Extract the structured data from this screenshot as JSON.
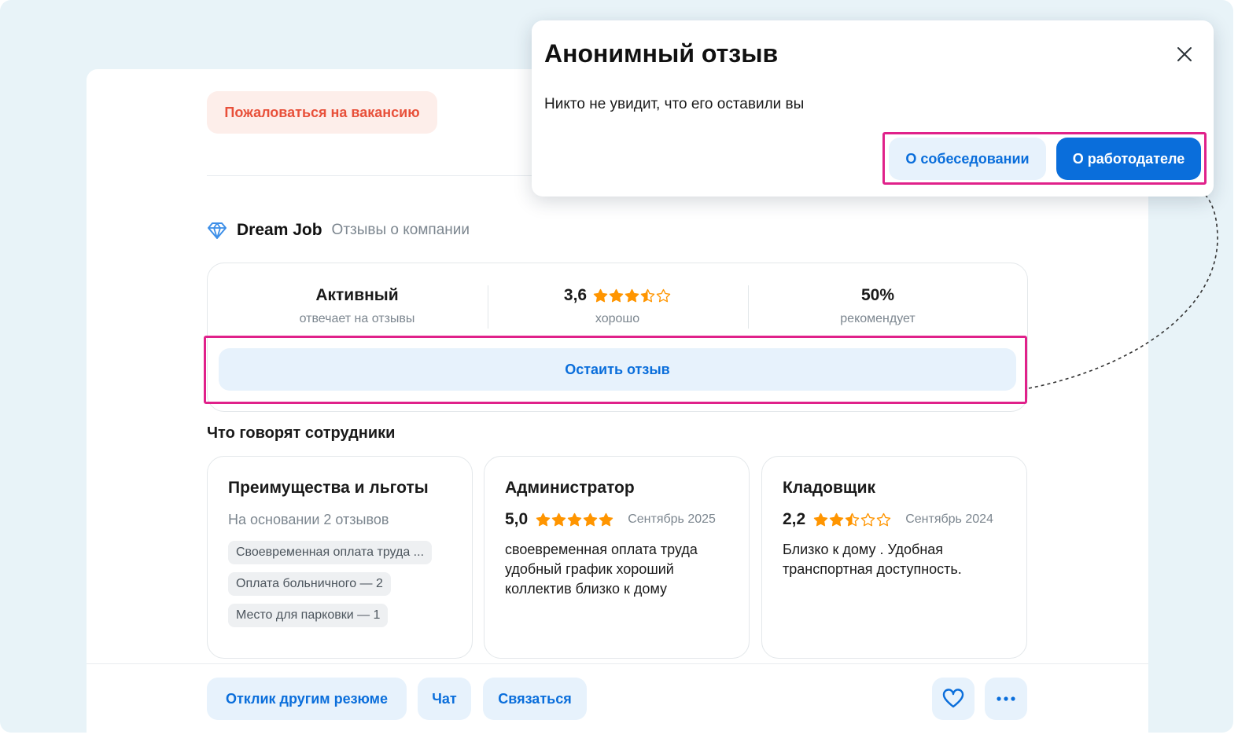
{
  "vacancy": {
    "complain_label": "Пожаловаться на вакансию"
  },
  "company": {
    "name": "Dream Job",
    "reviews_link": "Отзывы о компании",
    "stats": [
      {
        "value": "Активный",
        "label": "отвечает на отзывы"
      },
      {
        "value": "3,6",
        "label": "хорошо",
        "rating": 3.6
      },
      {
        "value": "50%",
        "label": "рекомендует"
      }
    ],
    "leave_review_label": "Остаить отзыв"
  },
  "employees": {
    "title": "Что говорят сотрудники",
    "benefits": {
      "title": "Преимущества и льготы",
      "subtitle": "На основании 2 отзывов",
      "tags": [
        "Своевременная оплата труда ...",
        "Оплата больничного — 2",
        "Место для парковки — 1"
      ]
    },
    "reviews": [
      {
        "role": "Администратор",
        "score": "5,0",
        "rating": 5.0,
        "date": "Сентябрь 2025",
        "text": "своевременная оплата труда удобный график хороший коллектив близко к дому"
      },
      {
        "role": "Кладовщик",
        "score": "2,2",
        "rating": 2.5,
        "date": "Сентябрь 2024",
        "text": "Близко к дому . Удобная транспортная доступность."
      }
    ]
  },
  "bottom_bar": {
    "respond_label": "Отклик другим резюме",
    "chat_label": "Чат",
    "contact_label": "Связаться"
  },
  "popup": {
    "title": "Анонимный отзыв",
    "text": "Никто не увидит, что его оставили вы",
    "interview_label": "О собеседовании",
    "employer_label": "О работодателе"
  },
  "colors": {
    "accent": "#0a6edb",
    "accent_light": "#e7f2fc",
    "star": "#ff9500",
    "highlight": "#e0218a",
    "danger": "#e8503a"
  }
}
